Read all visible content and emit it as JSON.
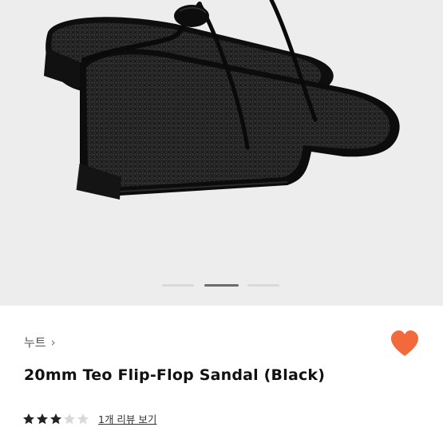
{
  "product": {
    "brand": "누트",
    "brand_chevron": "›",
    "title": "20mm Teo Flip-Flop Sandal (Black)",
    "rating": 3,
    "rating_max": 5,
    "review_link": "1개 리뷰 보기",
    "favorited": true
  },
  "gallery": {
    "image_count": 1,
    "active_index": 0,
    "image_icon": "sandal-image"
  },
  "colors": {
    "heart": "#f26a3c",
    "star_filled": "#222222",
    "star_empty": "#d9d9d9",
    "gallery_bg": "#ededed"
  }
}
